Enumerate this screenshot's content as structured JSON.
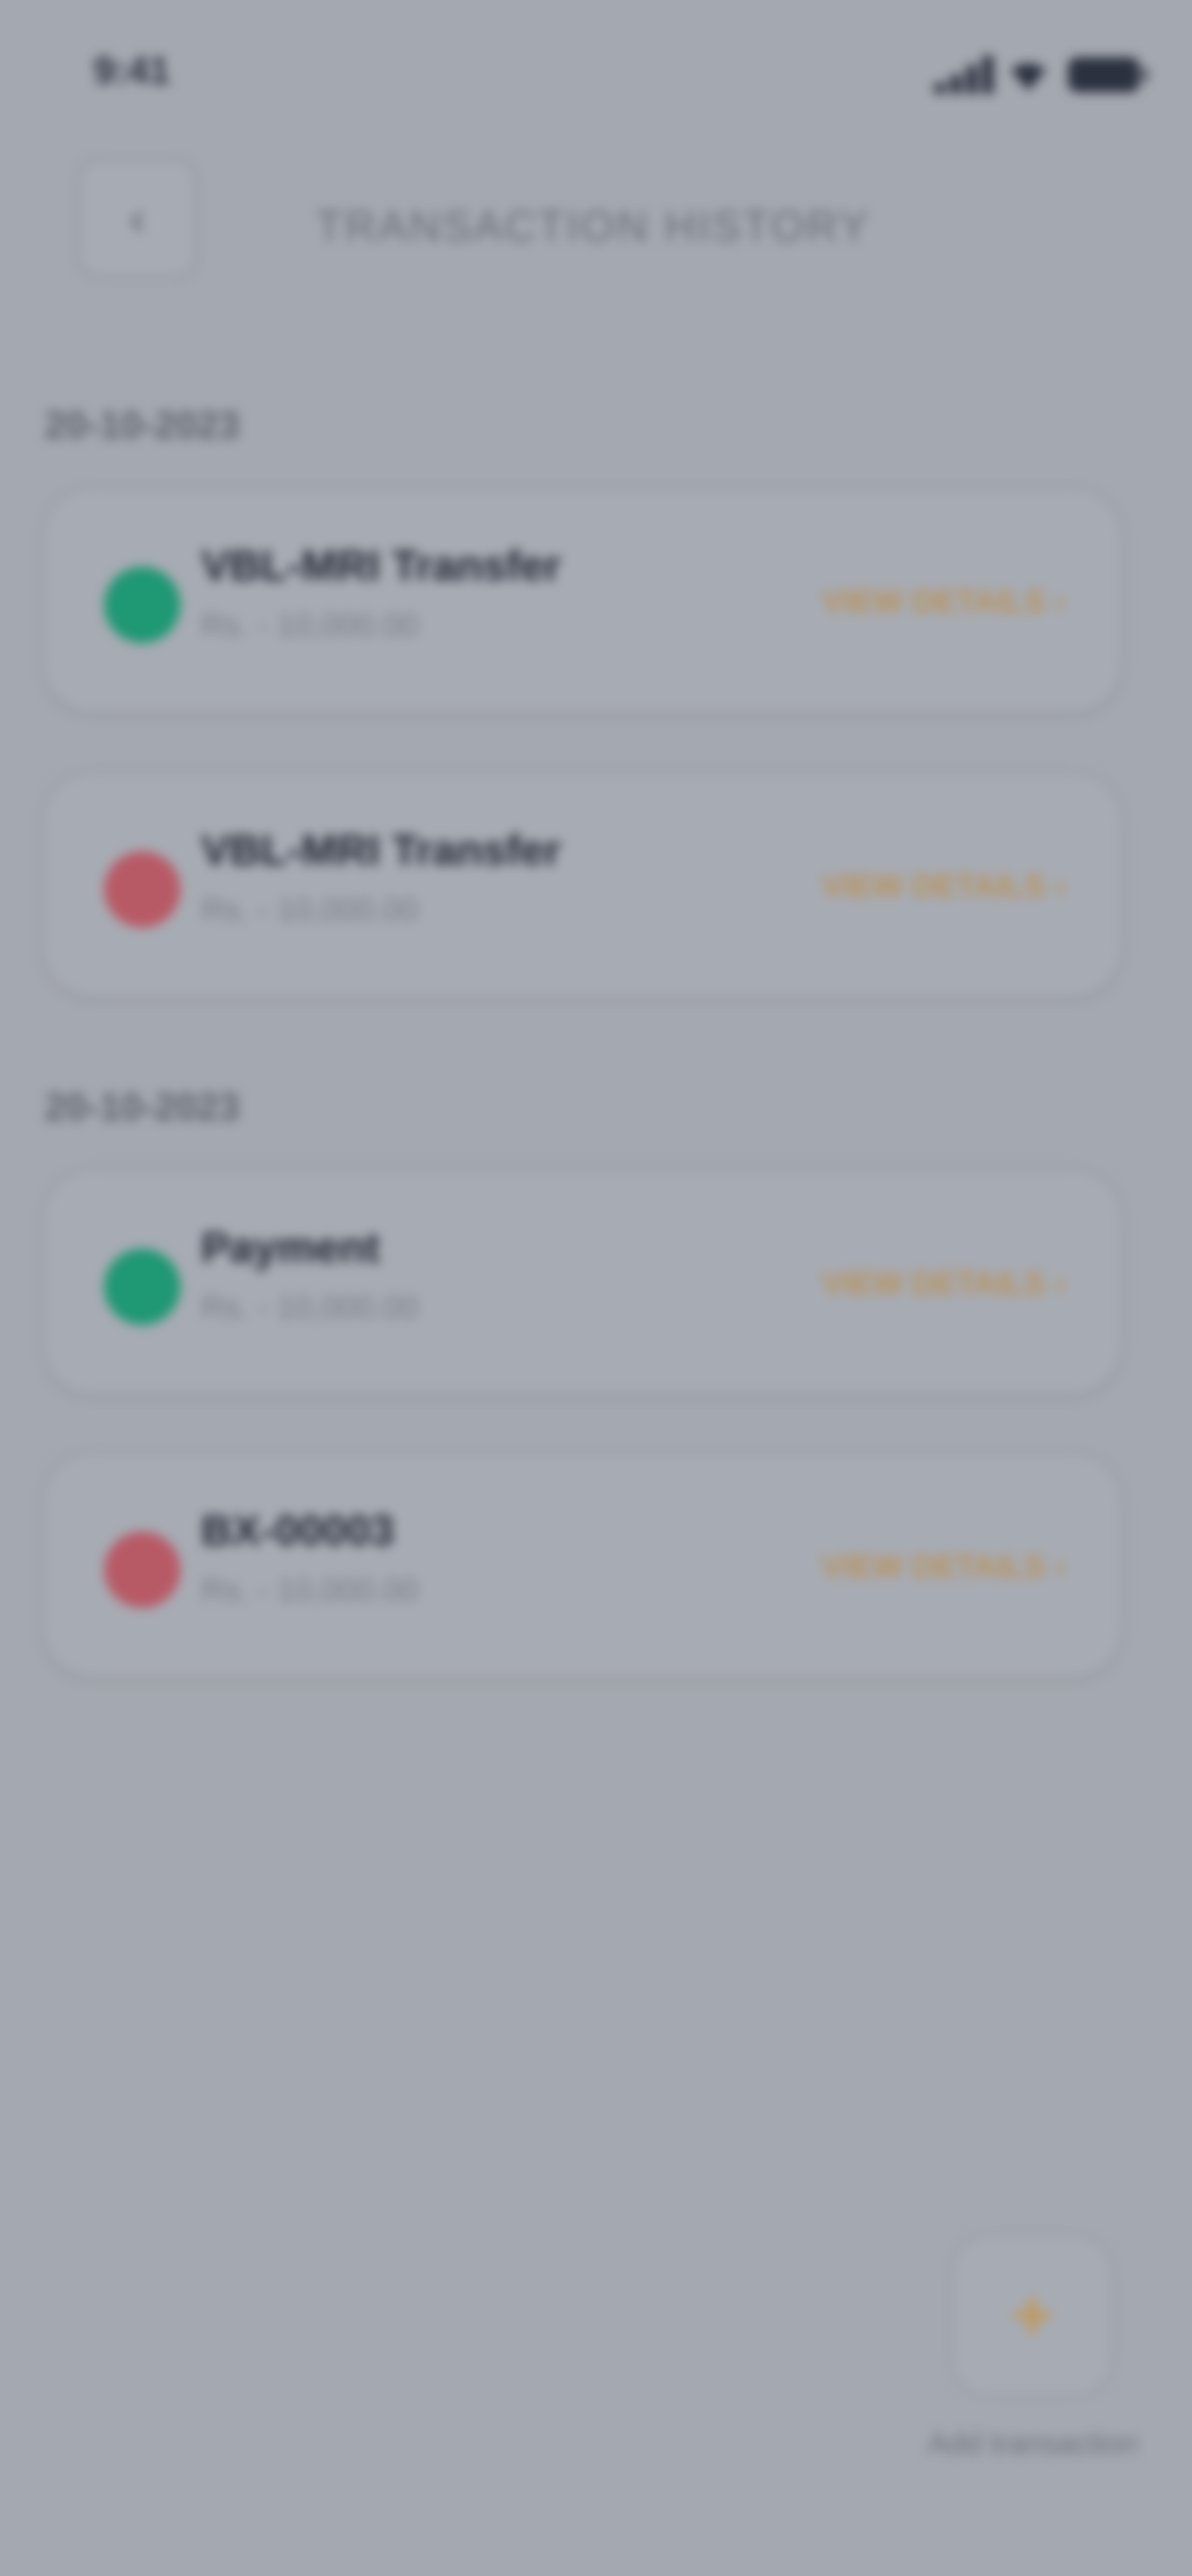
{
  "status_bar": {
    "time": "9:41"
  },
  "header": {
    "title": "TRANSACTION HISTORY",
    "back_icon": "back-arrow-icon"
  },
  "groups": [
    {
      "date": "20-10-2023",
      "transactions": [
        {
          "title": "VBL-MRI Transfer",
          "subtitle": "Rs. - 10,000.00",
          "direction": "in",
          "details_label": "VIEW DETAILS"
        },
        {
          "title": "VBL-MRI Transfer",
          "subtitle": "Rs. - 10,000.00",
          "direction": "out",
          "details_label": "VIEW DETAILS"
        }
      ]
    },
    {
      "date": "20-10-2023",
      "transactions": [
        {
          "title": "Payment",
          "subtitle": "Rs. - 10,000.00",
          "direction": "in",
          "details_label": "VIEW DETAILS"
        },
        {
          "title": "BX-00003",
          "subtitle": "Rs. - 10,000.00",
          "direction": "out",
          "details_label": "VIEW DETAILS"
        }
      ]
    }
  ],
  "colors": {
    "incoming": "#1f9874",
    "outgoing": "#b85a66",
    "accent": "#b9935c"
  },
  "fab": {
    "icon": "plus-icon",
    "label": "Add transaction"
  }
}
